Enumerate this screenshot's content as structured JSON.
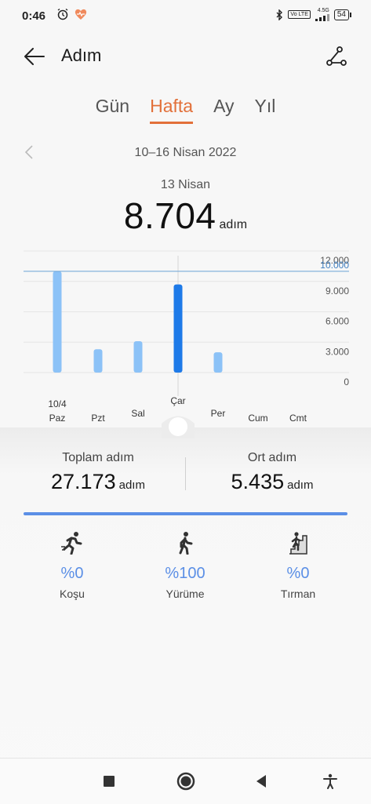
{
  "status": {
    "time": "0:46",
    "network": "4.5G",
    "battery": "54",
    "volte": "Vo LTE"
  },
  "header": {
    "title": "Adım"
  },
  "tabs": [
    {
      "label": "Gün"
    },
    {
      "label": "Hafta"
    },
    {
      "label": "Ay"
    },
    {
      "label": "Yıl"
    }
  ],
  "active_tab": "Hafta",
  "date_range": "10–16 Nisan 2022",
  "selected": {
    "date": "13 Nisan",
    "steps": "8.704",
    "unit": "adım"
  },
  "chart_data": {
    "type": "bar",
    "categories": [
      "Paz",
      "Pzt",
      "Sal",
      "Çar",
      "Per",
      "Cum",
      "Cmt"
    ],
    "first_date_label": "10/4",
    "values": [
      10000,
      2300,
      3100,
      8704,
      2000,
      0,
      0
    ],
    "selected_index": 3,
    "ylim": [
      0,
      12000
    ],
    "y_ticks": [
      "0",
      "3.000",
      "6.000",
      "9.000",
      "12.000"
    ],
    "goal": {
      "value": 10000,
      "label": "10.000"
    },
    "colors": {
      "bar": "#8cc2f7",
      "selected": "#1e7ae8",
      "goal": "#6aa3d6"
    }
  },
  "summary": {
    "total_label": "Toplam adım",
    "total_value": "27.173",
    "total_unit": "adım",
    "avg_label": "Ort adım",
    "avg_value": "5.435",
    "avg_unit": "adım"
  },
  "activities": [
    {
      "icon": "running-icon",
      "pct": "%0",
      "label": "Koşu"
    },
    {
      "icon": "walking-icon",
      "pct": "%100",
      "label": "Yürüme"
    },
    {
      "icon": "climbing-icon",
      "pct": "%0",
      "label": "Tırman"
    }
  ],
  "accent": "#e2703a",
  "blue": "#5b8fe6"
}
